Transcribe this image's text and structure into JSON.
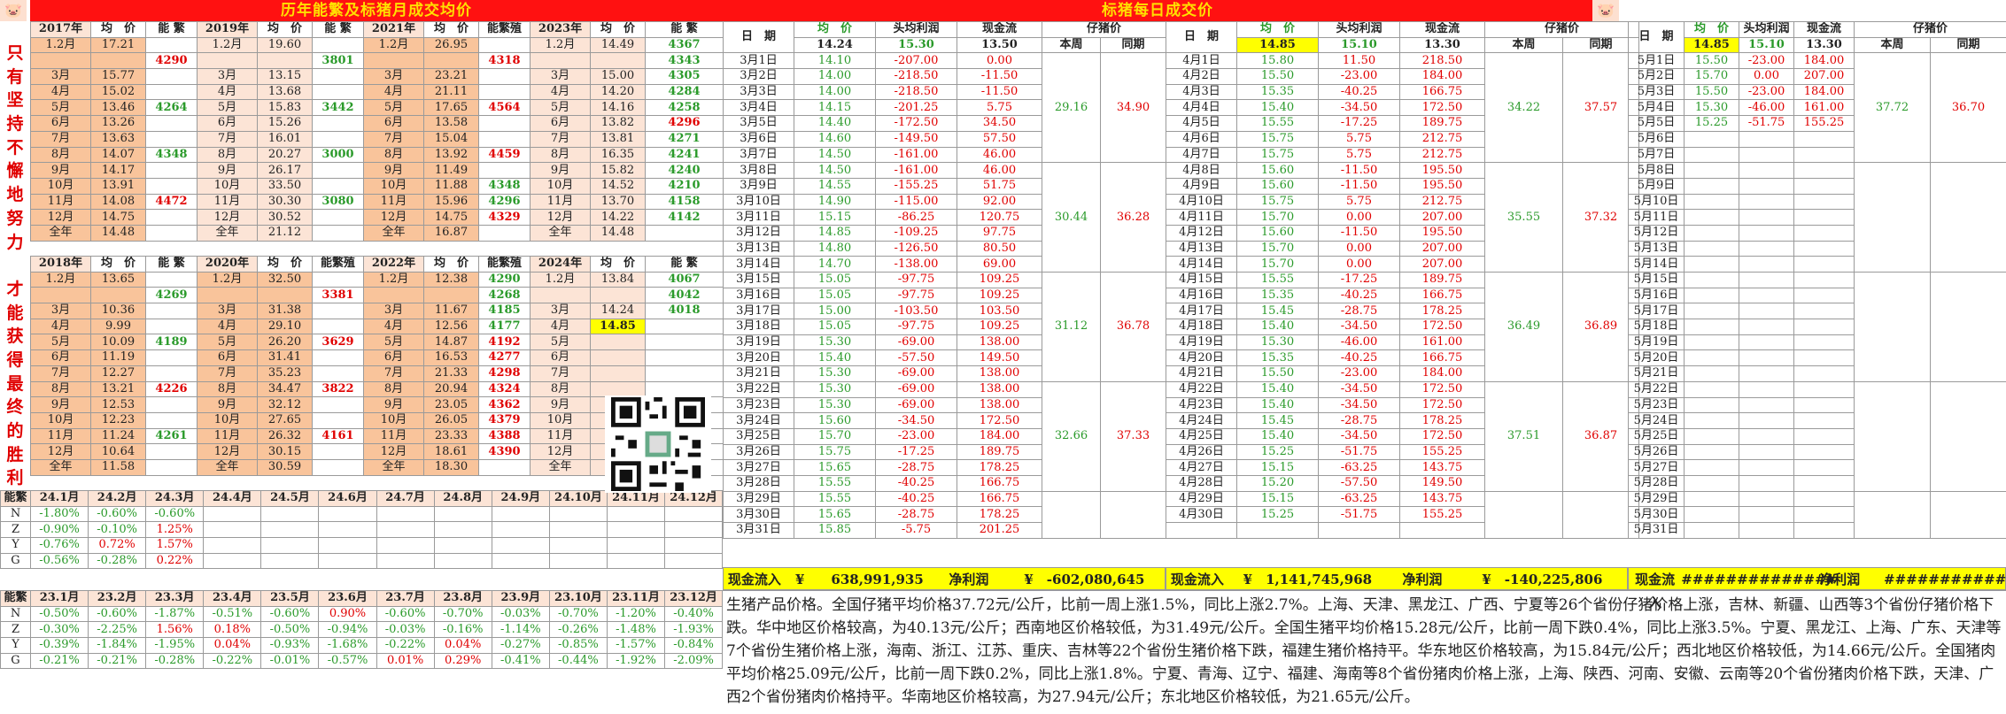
{
  "titles": {
    "left": "历年能繁及标猪月成交均价",
    "right": "标猪每日成交价"
  },
  "motto": [
    "只",
    "有",
    "坚",
    "持",
    "不",
    "懈",
    "地",
    "努",
    "力",
    "",
    "才",
    "能",
    "获",
    "得",
    "最",
    "终",
    "的",
    "胜",
    "利"
  ],
  "left_top": {
    "headers": [
      "2017年",
      "均　价",
      "能 繁",
      "2019年",
      "均　价",
      "能 繁",
      "2021年",
      "均　价",
      "能繁殖",
      "2023年",
      "均　价",
      "能 繁"
    ],
    "rows": [
      [
        "1.2月",
        "17.21",
        "",
        "1.2月",
        "19.60",
        "",
        "1.2月",
        "26.95",
        "",
        "1.2月",
        "14.49",
        "4367"
      ],
      [
        "",
        "",
        "4290",
        "",
        "",
        "3801",
        "",
        "",
        "4318",
        "",
        "",
        "4343"
      ],
      [
        "3月",
        "15.77",
        "",
        "3月",
        "13.15",
        "",
        "3月",
        "23.21",
        "",
        "3月",
        "15.00",
        "4305"
      ],
      [
        "4月",
        "15.02",
        "",
        "4月",
        "13.68",
        "",
        "4月",
        "21.11",
        "",
        "4月",
        "14.20",
        "4284"
      ],
      [
        "5月",
        "13.46",
        "4264",
        "5月",
        "15.83",
        "3442",
        "5月",
        "17.65",
        "4564",
        "5月",
        "14.16",
        "4258"
      ],
      [
        "6月",
        "13.26",
        "",
        "6月",
        "15.26",
        "",
        "6月",
        "13.58",
        "",
        "6月",
        "13.82",
        "4296"
      ],
      [
        "7月",
        "13.63",
        "",
        "7月",
        "16.01",
        "",
        "7月",
        "15.04",
        "",
        "7月",
        "13.81",
        "4271"
      ],
      [
        "8月",
        "14.07",
        "4348",
        "8月",
        "20.27",
        "3000",
        "8月",
        "13.92",
        "4459",
        "8月",
        "16.35",
        "4241"
      ],
      [
        "9月",
        "14.17",
        "",
        "9月",
        "26.17",
        "",
        "9月",
        "11.49",
        "",
        "9月",
        "15.82",
        "4240"
      ],
      [
        "10月",
        "13.91",
        "",
        "10月",
        "33.50",
        "",
        "10月",
        "11.88",
        "4348",
        "10月",
        "14.52",
        "4210"
      ],
      [
        "11月",
        "14.08",
        "4472",
        "11月",
        "30.30",
        "3080",
        "11月",
        "15.96",
        "4296",
        "11月",
        "13.70",
        "4158"
      ],
      [
        "12月",
        "14.75",
        "",
        "12月",
        "30.52",
        "",
        "12月",
        "14.75",
        "4329",
        "12月",
        "14.22",
        "4142"
      ],
      [
        "全年",
        "14.48",
        "",
        "全年",
        "21.12",
        "",
        "全年",
        "16.87",
        "",
        "全年",
        "14.48",
        ""
      ]
    ]
  },
  "left_bottom": {
    "headers": [
      "2018年",
      "均　价",
      "能 繁",
      "2020年",
      "均　价",
      "能繁殖",
      "2022年",
      "均　价",
      "能繁殖",
      "2024年",
      "均　价",
      "能 繁"
    ],
    "rows": [
      [
        "1.2月",
        "13.65",
        "",
        "1.2月",
        "32.50",
        "",
        "1.2月",
        "12.38",
        "4290",
        "1.2月",
        "13.84",
        "4067"
      ],
      [
        "",
        "",
        "4269",
        "",
        "",
        "3381",
        "",
        "",
        "4268",
        "",
        "",
        "4042"
      ],
      [
        "3月",
        "10.36",
        "",
        "3月",
        "31.38",
        "",
        "3月",
        "11.67",
        "4185",
        "3月",
        "14.24",
        "4018"
      ],
      [
        "4月",
        "9.99",
        "",
        "4月",
        "29.10",
        "",
        "4月",
        "12.56",
        "4177",
        "4月",
        "14.85",
        ""
      ],
      [
        "5月",
        "10.09",
        "4189",
        "5月",
        "26.20",
        "3629",
        "5月",
        "14.87",
        "4192",
        "5月",
        "",
        ""
      ],
      [
        "6月",
        "11.19",
        "",
        "6月",
        "31.41",
        "",
        "6月",
        "16.53",
        "4277",
        "6月",
        "",
        ""
      ],
      [
        "7月",
        "12.27",
        "",
        "7月",
        "35.23",
        "",
        "7月",
        "21.33",
        "4298",
        "7月",
        "",
        ""
      ],
      [
        "8月",
        "13.21",
        "4226",
        "8月",
        "34.47",
        "3822",
        "8月",
        "20.94",
        "4324",
        "8月",
        "",
        ""
      ],
      [
        "9月",
        "12.53",
        "",
        "9月",
        "32.12",
        "",
        "9月",
        "23.05",
        "4362",
        "9月",
        "",
        ""
      ],
      [
        "10月",
        "12.23",
        "",
        "10月",
        "27.65",
        "",
        "10月",
        "26.05",
        "4379",
        "10月",
        "",
        ""
      ],
      [
        "11月",
        "11.24",
        "4261",
        "11月",
        "26.32",
        "4161",
        "11月",
        "23.33",
        "4388",
        "11月",
        "",
        ""
      ],
      [
        "12月",
        "10.64",
        "",
        "12月",
        "30.15",
        "",
        "12月",
        "18.61",
        "4390",
        "12月",
        "",
        ""
      ],
      [
        "全年",
        "11.58",
        "",
        "全年",
        "30.59",
        "",
        "全年",
        "18.30",
        "",
        "全年",
        "",
        ""
      ]
    ]
  },
  "stats24": {
    "headers": [
      "能繁",
      "24.1月",
      "24.2月",
      "24.3月",
      "24.4月",
      "24.5月",
      "24.6月",
      "24.7月",
      "24.8月",
      "24.9月",
      "24.10月",
      "24.11月",
      "24.12月"
    ],
    "rows": [
      [
        "N",
        "-1.80%",
        "-0.60%",
        "-0.60%",
        "",
        "",
        "",
        "",
        "",
        "",
        "",
        "",
        ""
      ],
      [
        "Z",
        "-0.90%",
        "-0.10%",
        "1.25%",
        "",
        "",
        "",
        "",
        "",
        "",
        "",
        "",
        ""
      ],
      [
        "Y",
        "-0.76%",
        "0.72%",
        "1.57%",
        "",
        "",
        "",
        "",
        "",
        "",
        "",
        "",
        ""
      ],
      [
        "G",
        "-0.56%",
        "-0.28%",
        "0.22%",
        "",
        "",
        "",
        "",
        "",
        "",
        "",
        "",
        ""
      ]
    ]
  },
  "stats23": {
    "headers": [
      "能繁",
      "23.1月",
      "23.2月",
      "23.3月",
      "23.4月",
      "23.5月",
      "23.6月",
      "23.7月",
      "23.8月",
      "23.9月",
      "23.10月",
      "23.11月",
      "23.12月"
    ],
    "rows": [
      [
        "N",
        "-0.50%",
        "-0.60%",
        "-1.87%",
        "-0.51%",
        "-0.60%",
        "0.90%",
        "-0.60%",
        "-0.70%",
        "-0.03%",
        "-0.70%",
        "-1.20%",
        "-0.40%"
      ],
      [
        "Z",
        "-0.30%",
        "-2.25%",
        "1.56%",
        "0.18%",
        "-0.50%",
        "-0.94%",
        "-0.03%",
        "-0.16%",
        "-1.14%",
        "-0.26%",
        "-1.48%",
        "-1.93%"
      ],
      [
        "Y",
        "-0.39%",
        "-1.84%",
        "-1.95%",
        "0.04%",
        "-0.93%",
        "-1.68%",
        "-0.22%",
        "0.04%",
        "-0.27%",
        "-0.85%",
        "-1.57%",
        "-0.84%"
      ],
      [
        "G",
        "-0.21%",
        "-0.21%",
        "-0.28%",
        "-0.22%",
        "-0.01%",
        "-0.57%",
        "0.01%",
        "0.29%",
        "-0.41%",
        "-0.44%",
        "-1.92%",
        "-2.09%"
      ]
    ]
  },
  "daily_headers": {
    "date": "日　期",
    "avg": "均　价",
    "head": "头均利润",
    "cash": "现金流",
    "piglet": "仔猪价",
    "week": "本周",
    "yoy": "同期"
  },
  "march": {
    "top": [
      "14.24",
      "15.30",
      "13.50"
    ],
    "rows": [
      [
        "3月1日",
        "14.10",
        "-207.00",
        "0.00"
      ],
      [
        "3月2日",
        "14.00",
        "-218.50",
        "-11.50"
      ],
      [
        "3月3日",
        "14.00",
        "-218.50",
        "-11.50"
      ],
      [
        "3月4日",
        "14.15",
        "-201.25",
        "5.75"
      ],
      [
        "3月5日",
        "14.40",
        "-172.50",
        "34.50"
      ],
      [
        "3月6日",
        "14.60",
        "-149.50",
        "57.50"
      ],
      [
        "3月7日",
        "14.50",
        "-161.00",
        "46.00"
      ],
      [
        "3月8日",
        "14.50",
        "-161.00",
        "46.00"
      ],
      [
        "3月9日",
        "14.55",
        "-155.25",
        "51.75"
      ],
      [
        "3月10日",
        "14.90",
        "-115.00",
        "92.00"
      ],
      [
        "3月11日",
        "15.15",
        "-86.25",
        "120.75"
      ],
      [
        "3月12日",
        "14.85",
        "-109.25",
        "97.75"
      ],
      [
        "3月13日",
        "14.80",
        "-126.50",
        "80.50"
      ],
      [
        "3月14日",
        "14.70",
        "-138.00",
        "69.00"
      ],
      [
        "3月15日",
        "15.05",
        "-97.75",
        "109.25"
      ],
      [
        "3月16日",
        "15.05",
        "-97.75",
        "109.25"
      ],
      [
        "3月17日",
        "15.00",
        "-103.50",
        "103.50"
      ],
      [
        "3月18日",
        "15.05",
        "-97.75",
        "109.25"
      ],
      [
        "3月19日",
        "15.30",
        "-69.00",
        "138.00"
      ],
      [
        "3月20日",
        "15.40",
        "-57.50",
        "149.50"
      ],
      [
        "3月21日",
        "15.30",
        "-69.00",
        "138.00"
      ],
      [
        "3月22日",
        "15.30",
        "-69.00",
        "138.00"
      ],
      [
        "3月23日",
        "15.30",
        "-69.00",
        "138.00"
      ],
      [
        "3月24日",
        "15.60",
        "-34.50",
        "172.50"
      ],
      [
        "3月25日",
        "15.70",
        "-23.00",
        "184.00"
      ],
      [
        "3月26日",
        "15.75",
        "-17.25",
        "189.75"
      ],
      [
        "3月27日",
        "15.65",
        "-28.75",
        "178.25"
      ],
      [
        "3月28日",
        "15.55",
        "-40.25",
        "166.75"
      ],
      [
        "3月29日",
        "15.55",
        "-40.25",
        "166.75"
      ],
      [
        "3月30日",
        "15.65",
        "-28.75",
        "178.25"
      ],
      [
        "3月31日",
        "15.85",
        "-5.75",
        "201.25"
      ]
    ],
    "piglet": [
      [
        "29.16",
        "34.90"
      ],
      [
        "30.44",
        "36.28"
      ],
      [
        "31.12",
        "36.78"
      ],
      [
        "32.66",
        "37.33"
      ]
    ],
    "summary": {
      "cash_label": "现金流入",
      "cash_value": "¥　　638,991,935",
      "profit_label": "净利润",
      "profit_value": "¥　-602,080,645"
    }
  },
  "april": {
    "top": [
      "14.85",
      "15.10",
      "13.30"
    ],
    "rows": [
      [
        "4月1日",
        "15.80",
        "11.50",
        "218.50"
      ],
      [
        "4月2日",
        "15.50",
        "-23.00",
        "184.00"
      ],
      [
        "4月3日",
        "15.35",
        "-40.25",
        "166.75"
      ],
      [
        "4月4日",
        "15.40",
        "-34.50",
        "172.50"
      ],
      [
        "4月5日",
        "15.55",
        "-17.25",
        "189.75"
      ],
      [
        "4月6日",
        "15.75",
        "5.75",
        "212.75"
      ],
      [
        "4月7日",
        "15.75",
        "5.75",
        "212.75"
      ],
      [
        "4月8日",
        "15.60",
        "-11.50",
        "195.50"
      ],
      [
        "4月9日",
        "15.60",
        "-11.50",
        "195.50"
      ],
      [
        "4月10日",
        "15.75",
        "5.75",
        "212.75"
      ],
      [
        "4月11日",
        "15.70",
        "0.00",
        "207.00"
      ],
      [
        "4月12日",
        "15.60",
        "-11.50",
        "195.50"
      ],
      [
        "4月13日",
        "15.70",
        "0.00",
        "207.00"
      ],
      [
        "4月14日",
        "15.70",
        "0.00",
        "207.00"
      ],
      [
        "4月15日",
        "15.55",
        "-17.25",
        "189.75"
      ],
      [
        "4月16日",
        "15.35",
        "-40.25",
        "166.75"
      ],
      [
        "4月17日",
        "15.45",
        "-28.75",
        "178.25"
      ],
      [
        "4月18日",
        "15.40",
        "-34.50",
        "172.50"
      ],
      [
        "4月19日",
        "15.30",
        "-46.00",
        "161.00"
      ],
      [
        "4月20日",
        "15.35",
        "-40.25",
        "166.75"
      ],
      [
        "4月21日",
        "15.50",
        "-23.00",
        "184.00"
      ],
      [
        "4月22日",
        "15.40",
        "-34.50",
        "172.50"
      ],
      [
        "4月23日",
        "15.40",
        "-34.50",
        "172.50"
      ],
      [
        "4月24日",
        "15.45",
        "-28.75",
        "178.25"
      ],
      [
        "4月25日",
        "15.40",
        "-34.50",
        "172.50"
      ],
      [
        "4月26日",
        "15.25",
        "-51.75",
        "155.25"
      ],
      [
        "4月27日",
        "15.15",
        "-63.25",
        "143.75"
      ],
      [
        "4月28日",
        "15.20",
        "-57.50",
        "149.50"
      ],
      [
        "4月29日",
        "15.15",
        "-63.25",
        "143.75"
      ],
      [
        "4月30日",
        "15.25",
        "-51.75",
        "155.25"
      ],
      [
        "",
        "",
        " ",
        ""
      ]
    ],
    "piglet": [
      [
        "34.22",
        "37.57"
      ],
      [
        "35.55",
        "37.32"
      ],
      [
        "36.49",
        "36.89"
      ],
      [
        "37.51",
        "36.87"
      ]
    ],
    "summary": {
      "cash_label": "现金流入",
      "cash_value": "¥　1,141,745,968",
      "profit_label": "净利润",
      "profit_value": "¥　-140,225,806"
    }
  },
  "may": {
    "top": [
      "14.85",
      "15.10",
      "13.30"
    ],
    "rows": [
      [
        "5月1日",
        "15.50",
        "-23.00",
        "184.00"
      ],
      [
        "5月2日",
        "15.70",
        "0.00",
        "207.00"
      ],
      [
        "5月3日",
        "15.50",
        "-23.00",
        "184.00"
      ],
      [
        "5月4日",
        "15.30",
        "-46.00",
        "161.00"
      ],
      [
        "5月5日",
        "15.25",
        "-51.75",
        "155.25"
      ],
      [
        "5月6日",
        "",
        "",
        ""
      ],
      [
        "5月7日",
        "",
        "",
        ""
      ],
      [
        "5月8日",
        "",
        "",
        ""
      ],
      [
        "5月9日",
        "",
        "",
        ""
      ],
      [
        "5月10日",
        "",
        "",
        ""
      ],
      [
        "5月11日",
        "",
        "",
        ""
      ],
      [
        "5月12日",
        "",
        "",
        ""
      ],
      [
        "5月13日",
        "",
        "",
        ""
      ],
      [
        "5月14日",
        "",
        "",
        ""
      ],
      [
        "5月15日",
        "",
        "",
        ""
      ],
      [
        "5月16日",
        "",
        "",
        ""
      ],
      [
        "5月17日",
        "",
        "",
        ""
      ],
      [
        "5月18日",
        "",
        "",
        ""
      ],
      [
        "5月19日",
        "",
        "",
        ""
      ],
      [
        "5月20日",
        "",
        "",
        ""
      ],
      [
        "5月21日",
        "",
        "",
        ""
      ],
      [
        "5月22日",
        "",
        "",
        ""
      ],
      [
        "5月23日",
        "",
        "",
        ""
      ],
      [
        "5月24日",
        "",
        "",
        ""
      ],
      [
        "5月25日",
        "",
        "",
        ""
      ],
      [
        "5月26日",
        "",
        "",
        ""
      ],
      [
        "5月27日",
        "",
        "",
        ""
      ],
      [
        "5月28日",
        "",
        "",
        ""
      ],
      [
        "5月29日",
        "",
        "",
        ""
      ],
      [
        "5月30日",
        "",
        "",
        ""
      ],
      [
        "5月31日",
        "",
        "",
        ""
      ]
    ],
    "piglet": [
      [
        "37.72",
        "36.70"
      ]
    ],
    "summary": {
      "cash_label": "现金流入",
      "cash_value": "##############",
      "profit_label": "净利润",
      "profit_value": "##############"
    }
  },
  "news": "生猪产品价格。全国仔猪平均价格37.72元/公斤，比前一周上涨1.5%，同比上涨2.7%。上海、天津、黑龙江、广西、宁夏等26个省份仔猪价格上涨，吉林、新疆、山西等3个省份仔猪价格下跌。华中地区价格较高，为40.13元/公斤；西南地区价格较低，为31.49元/公斤。全国生猪平均价格15.28元/公斤，比前一周下跌0.4%，同比上涨3.5%。宁夏、黑龙江、上海、广东、天津等7个省份生猪价格上涨，海南、浙江、江苏、重庆、吉林等22个省份生猪价格下跌，福建生猪价格持平。华东地区价格较高，为15.84元/公斤；西北地区价格较低，为14.66元/公斤。全国猪肉平均价格25.09元/公斤，比前一周下跌0.2%，同比上涨1.8%。宁夏、青海、辽宁、福建、海南等8个省份猪肉价格上涨，上海、陕西、河南、安徽、云南等20个省份猪肉价格下跌，天津、广西2个省份猪肉价格持平。华南地区价格较高，为27.94元/公斤；东北地区价格较低，为21.65元/公斤。",
  "colors": {
    "title_bg": "#ff1111",
    "title_fg": "#ffe000",
    "orange": "#f9c49b",
    "peach": "#fce4d6",
    "green": "#2a9a2a",
    "red": "#e00000",
    "yellow": "#ffff00"
  }
}
